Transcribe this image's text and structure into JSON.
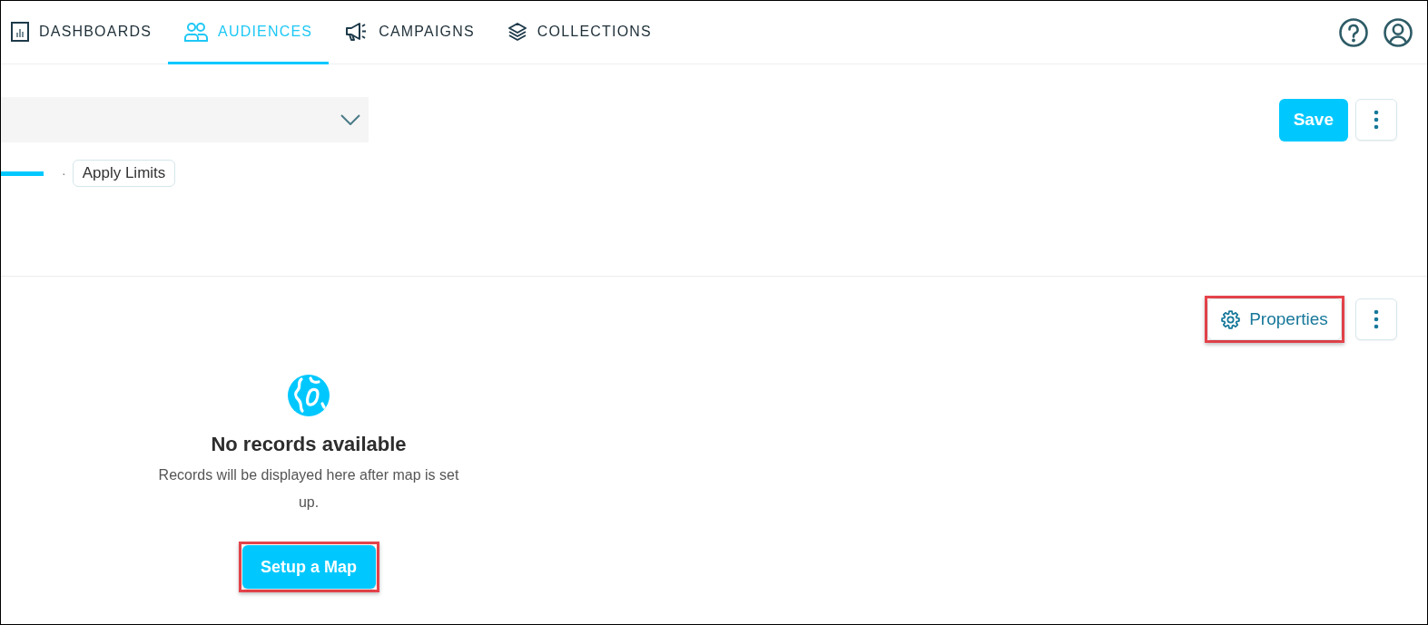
{
  "nav": {
    "tabs": [
      {
        "label": "DASHBOARDS",
        "selected": false
      },
      {
        "label": "AUDIENCES",
        "selected": true
      },
      {
        "label": "CAMPAIGNS",
        "selected": false
      },
      {
        "label": "COLLECTIONS",
        "selected": false
      }
    ]
  },
  "header_buttons": [
    {
      "kind": "primary",
      "label": "Save"
    },
    {
      "kind": "more"
    }
  ],
  "filters": {
    "separator": "·",
    "chip": "Apply Limits"
  },
  "map_panel": {
    "buttons": [
      {
        "kind": "settings",
        "label": "Properties",
        "highlighted": true
      },
      {
        "kind": "more",
        "highlighted": false
      }
    ],
    "empty_state": {
      "title": "No records available",
      "message": "Records will be displayed here after map is set up.",
      "button": {
        "label": "Setup a Map",
        "highlighted": true
      }
    }
  }
}
